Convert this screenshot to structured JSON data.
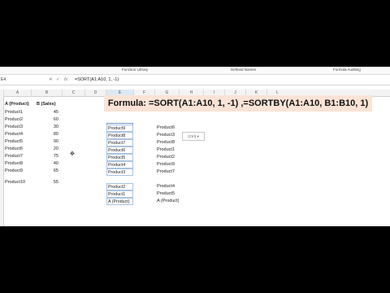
{
  "ribbon": {
    "groups": [
      "Function Library",
      "Defined Names",
      "Formula Auditing"
    ]
  },
  "formula_bar": {
    "name_box": "E4",
    "cancel_icon": "✕",
    "enter_icon": "✓",
    "fx_label": "fx",
    "formula": "=SORT(A1:A10, 1, -1)"
  },
  "columns": [
    "A",
    "B",
    "C",
    "D",
    "E",
    "F",
    "G",
    "H",
    "I",
    "J",
    "K",
    "L"
  ],
  "headers": {
    "a": "A (Product)",
    "b": "B (Sales)"
  },
  "source_rows": [
    {
      "product": "Product1",
      "sales": "45"
    },
    {
      "product": "Product2",
      "sales": "60"
    },
    {
      "product": "Product3",
      "sales": "30"
    },
    {
      "product": "Product4",
      "sales": "80"
    },
    {
      "product": "Product5",
      "sales": "90"
    },
    {
      "product": "Product6",
      "sales": "20"
    },
    {
      "product": "Product7",
      "sales": "75"
    },
    {
      "product": "Product8",
      "sales": "40"
    },
    {
      "product": "Product9",
      "sales": "65"
    },
    {
      "product": "Product10",
      "sales": "55"
    }
  ],
  "banner": "Formula: =SORT(A1:A10, 1, -1) ,=SORTBY(A1:A10, B1:B10, 1)",
  "sort_result": [
    "Product9",
    "Product8",
    "Product7",
    "Product6",
    "Product5",
    "Product4",
    "Product3",
    "",
    "Product2",
    "Product1",
    "A (Product)"
  ],
  "sortby_result": [
    "Product6",
    "Product3",
    "Product8",
    "Product1",
    "Product2",
    "Product9",
    "Product7",
    "",
    "Product4",
    "Product5",
    "A (Product)"
  ],
  "paste_options": "(Ctrl) ▾",
  "cursor_icon": "✥"
}
